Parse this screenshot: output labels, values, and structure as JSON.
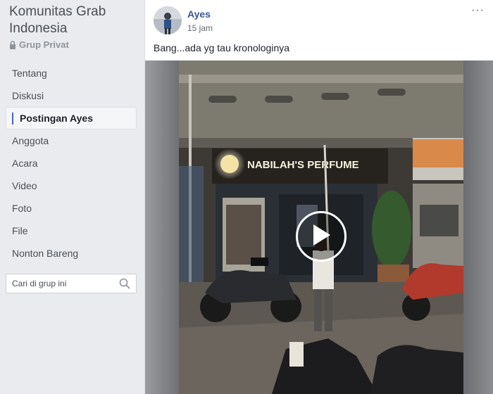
{
  "group": {
    "title": "Komunitas Grab Indonesia",
    "privacy": "Grup Privat",
    "privacy_icon": "lock-icon"
  },
  "sidebar": {
    "items": [
      {
        "label": "Tentang",
        "active": false
      },
      {
        "label": "Diskusi",
        "active": false
      },
      {
        "label": "Postingan Ayes",
        "active": true
      },
      {
        "label": "Anggota",
        "active": false
      },
      {
        "label": "Acara",
        "active": false
      },
      {
        "label": "Video",
        "active": false
      },
      {
        "label": "Foto",
        "active": false
      },
      {
        "label": "File",
        "active": false
      },
      {
        "label": "Nonton Bareng",
        "active": false
      }
    ]
  },
  "search": {
    "placeholder": "Cari di grup ini",
    "icon": "search-icon"
  },
  "post": {
    "author": "Ayes",
    "time": "15 jam",
    "text": "Bang...ada yg tau kronologinya",
    "more_label": "···",
    "video": {
      "sign_text": "NABILAH'S PERFUME",
      "play_icon": "play-icon"
    }
  },
  "colors": {
    "background": "#e9ebee",
    "link": "#385898",
    "accent": "#4267b2"
  }
}
